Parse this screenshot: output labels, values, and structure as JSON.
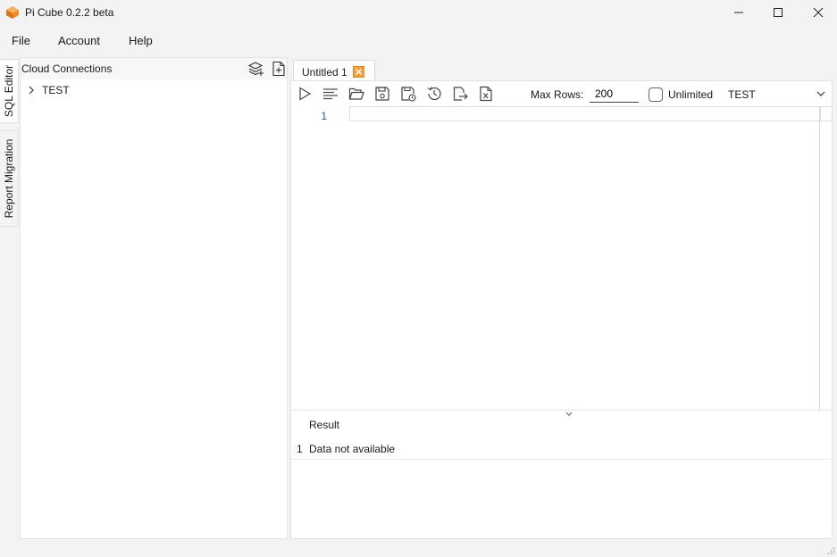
{
  "window": {
    "title": "Pi Cube 0.2.2 beta",
    "accent": "#f08a24"
  },
  "menu": {
    "items": [
      "File",
      "Account",
      "Help"
    ]
  },
  "side_tabs": {
    "sql_editor": "SQL Editor",
    "report_migration": "Report Migration"
  },
  "connections": {
    "title": "Cloud Connections",
    "icons": [
      "layers-add-icon",
      "new-file-icon"
    ],
    "tree": [
      {
        "label": "TEST",
        "expanded": false
      }
    ]
  },
  "editor": {
    "tab_label": "Untitled 1",
    "toolbar_icons": [
      "run-icon",
      "format-icon",
      "open-folder-icon",
      "save-icon",
      "save-as-icon",
      "history-icon",
      "export-icon",
      "excel-export-icon"
    ],
    "max_rows_label": "Max Rows:",
    "max_rows_value": "200",
    "unlimited_label": "Unlimited",
    "unlimited_checked": false,
    "connection_selected": "TEST",
    "line_numbers": [
      "1"
    ],
    "code": ""
  },
  "result": {
    "header": "Result",
    "rows": [
      {
        "no": "1",
        "text": "Data not available"
      }
    ]
  }
}
